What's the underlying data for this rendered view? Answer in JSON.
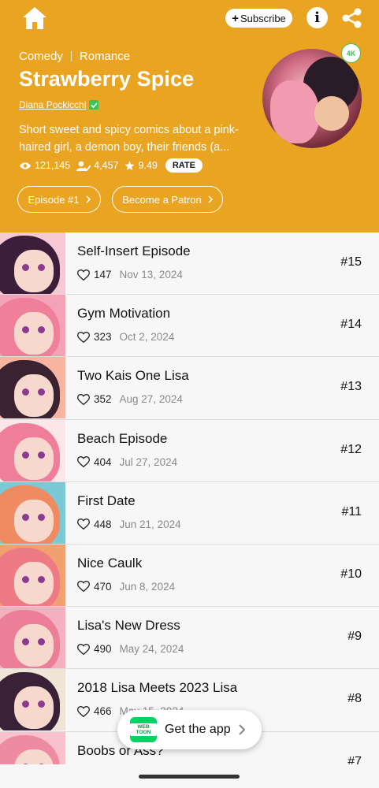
{
  "header": {
    "subscribe_label": "Subscribe",
    "genres": [
      "Comedy",
      "Romance"
    ],
    "title": "Strawberry Spice",
    "author": "Diana Pockicchi",
    "description_line1": "Short sweet and spicy comics about a pink-",
    "description_line2": "haired girl, a demon boy, their friends (a...",
    "views": "121,145",
    "subscribers": "4,457",
    "rating": "9.49",
    "rate_label": "RATE",
    "episode_button": "Episode #1",
    "patron_button": "Become a Patron",
    "cover_badge": "4K",
    "bg_color": "#e9a521"
  },
  "episodes": [
    {
      "title": "Self-Insert Episode",
      "likes": "147",
      "date": "Nov 13, 2024",
      "number": "#15"
    },
    {
      "title": "Gym Motivation",
      "likes": "323",
      "date": "Oct 2, 2024",
      "number": "#14"
    },
    {
      "title": "Two Kais One Lisa",
      "likes": "352",
      "date": "Aug 27, 2024",
      "number": "#13"
    },
    {
      "title": "Beach Episode",
      "likes": "404",
      "date": "Jul 27, 2024",
      "number": "#12"
    },
    {
      "title": "First Date",
      "likes": "448",
      "date": "Jun 21, 2024",
      "number": "#11"
    },
    {
      "title": "Nice Caulk",
      "likes": "470",
      "date": "Jun 8, 2024",
      "number": "#10"
    },
    {
      "title": "Lisa's New Dress",
      "likes": "490",
      "date": "May 24, 2024",
      "number": "#9"
    },
    {
      "title": "2018 Lisa Meets 2023 Lisa",
      "likes": "466",
      "date": "May 15, 2024",
      "number": "#8"
    },
    {
      "title": "Boobs or Ass?",
      "likes": "",
      "date": "",
      "number": "#7"
    }
  ],
  "get_app": {
    "label": "Get the app",
    "logo_text": "WEB TOON",
    "logo_color": "#00d564"
  }
}
